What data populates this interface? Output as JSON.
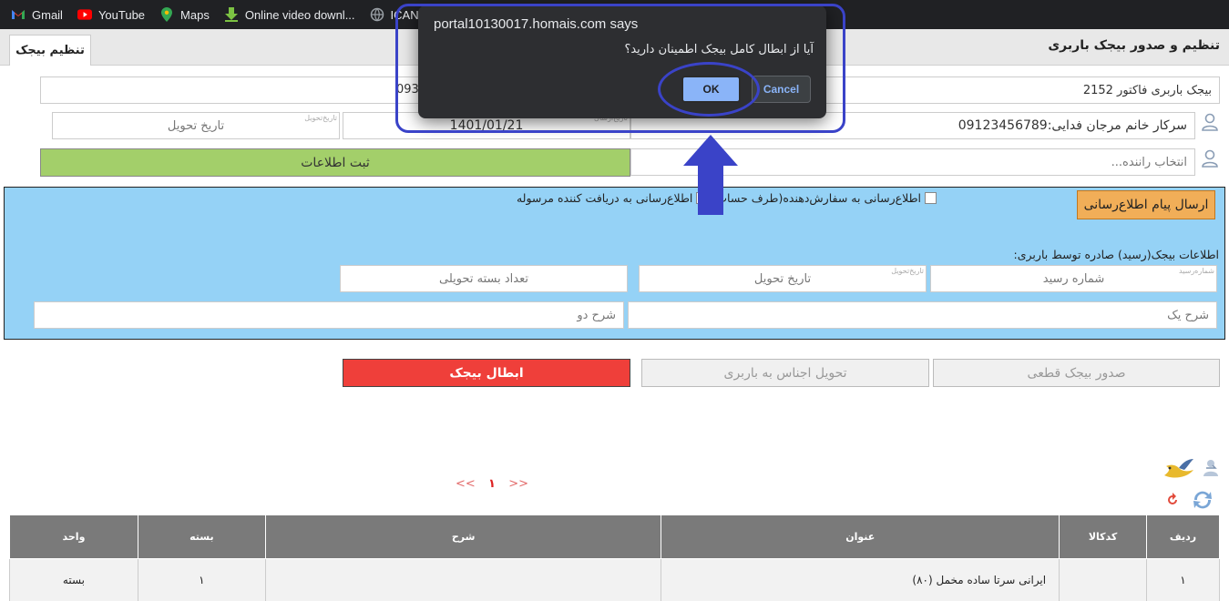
{
  "bookmarks": [
    {
      "label": "Gmail",
      "icon": "gmail-icon"
    },
    {
      "label": "YouTube",
      "icon": "youtube-icon"
    },
    {
      "label": "Maps",
      "icon": "maps-icon"
    },
    {
      "label": "Online video downl...",
      "icon": "download-icon"
    },
    {
      "label": "ICANN L",
      "icon": "icann-icon"
    }
  ],
  "header": {
    "title": "تنظیم و صدور بیجک باربری",
    "active_tab": "تنظیم بیجک"
  },
  "form": {
    "invoice": "بیجک باربری فاکتور 2152",
    "invoice_left_partial": "093",
    "customer": "سرکار خانم مرجان فدایی:09123456789",
    "send_date": "1401/01/21",
    "send_date_hint": "تاریخ‌ارسال",
    "delivery_date_placeholder": "تاریخ تحویل",
    "delivery_date_hint": "تاریخ‌تحویل",
    "driver_placeholder": "انتخاب راننده...",
    "submit_label": "ثبت اطلاعات"
  },
  "notify": {
    "send_button": "ارسال پیام اطلاع‌رسانی",
    "check_orderer": "اطلاع‌رسانی به سفارش‌دهنده(طرف حساب)",
    "check_receiver": "اطلاع‌رسانی به دریافت کننده مرسوله",
    "receipt_section": "اطلاعات بیجک(رسید) صادره توسط باربری:",
    "receipt_no_placeholder": "شماره رسید",
    "receipt_no_hint": "شماره‌رسید",
    "delivery_date_placeholder": "تاریخ تحویل",
    "delivery_date_hint": "تاریخ‌تحویل",
    "package_count_placeholder": "تعداد بسته تحویلی",
    "desc1_placeholder": "شرح یک",
    "desc2_placeholder": "شرح دو"
  },
  "actions": {
    "final_issue": "صدور بیجک قطعی",
    "deliver": "تحویل اجناس به باربری",
    "cancel": "ابطال بیجک"
  },
  "pager": {
    "prev": "<<",
    "current": "۱",
    "next": ">>"
  },
  "table": {
    "headers": [
      "ردیف",
      "کدکالا",
      "عنوان",
      "شرح",
      "بسته",
      "واحد"
    ],
    "rows": [
      [
        "۱",
        "",
        "ایرانی سرتا ساده مخمل (۸۰)",
        "",
        "۱",
        "بسته"
      ]
    ]
  },
  "dialog": {
    "title": "portal10130017.homais.com says",
    "message": "آیا از ابطال کامل بیجک اطمینان دارید؟",
    "ok": "OK",
    "cancel": "Cancel"
  },
  "colors": {
    "annotation": "#3a43c8",
    "panel_blue": "#95d2f6",
    "submit_green": "#a3cf6a",
    "cancel_red": "#ef3f3a",
    "send_orange": "#f1ae58"
  }
}
